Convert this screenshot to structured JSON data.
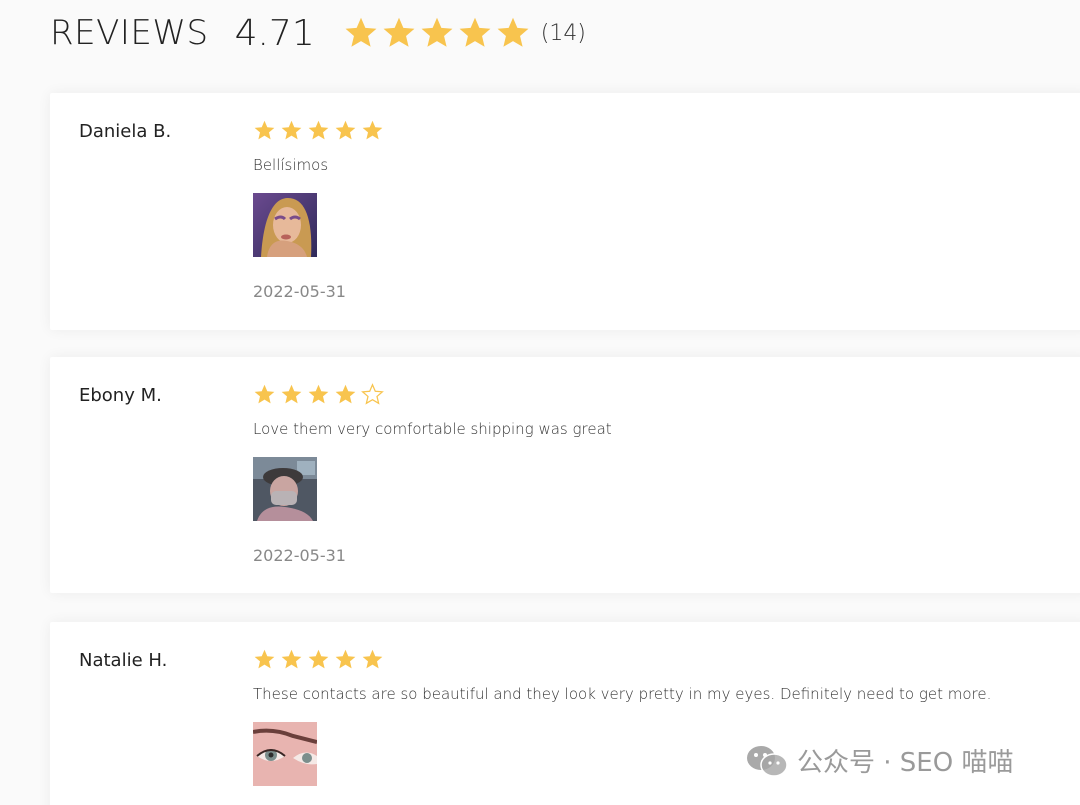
{
  "header": {
    "title": "REVIEWS",
    "average": "4.71",
    "average_stars": 5,
    "count": "(14)"
  },
  "colors": {
    "star": "#F8C44E",
    "star_empty_stroke": "#F8C44E",
    "date": "#888888"
  },
  "reviews": [
    {
      "name": "Daniela B.",
      "rating": 5,
      "text": "Bellísimos",
      "photo_icon": "reviewer-photo-purple-makeup",
      "date": "2022-05-31"
    },
    {
      "name": "Ebony M.",
      "rating": 4,
      "text": "Love them very comfortable shipping was great",
      "photo_icon": "reviewer-photo-selfie-car",
      "date": "2022-05-31"
    },
    {
      "name": "Natalie H.",
      "rating": 5,
      "text": "These contacts are so beautiful and they look very pretty in my eyes. Definitely need to get more.",
      "photo_icon": "reviewer-photo-eyes-closeup",
      "date": ""
    }
  ],
  "watermark": {
    "icon": "wechat-icon",
    "text": "公众号 · SEO 喵喵"
  }
}
